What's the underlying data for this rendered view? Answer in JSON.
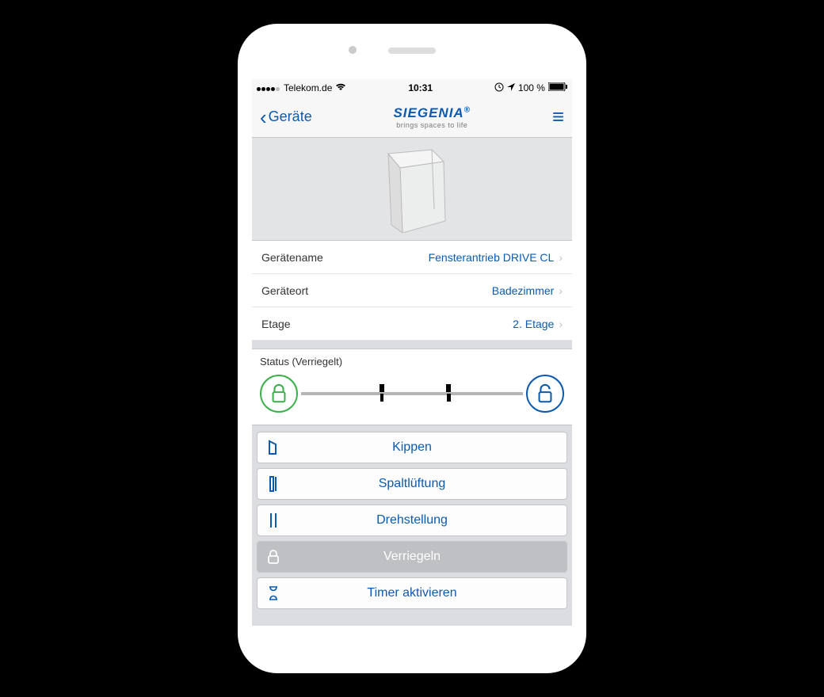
{
  "statusbar": {
    "carrier": "Telekom.de",
    "time": "10:31",
    "battery": "100 %"
  },
  "nav": {
    "back_label": "Geräte",
    "logo_main": "SIEGENIA",
    "logo_sub": "brings spaces to life"
  },
  "props": {
    "name_label": "Gerätename",
    "name_value": "Fensterantrieb DRIVE CL",
    "loc_label": "Geräteort",
    "loc_value": "Badezimmer",
    "floor_label": "Etage",
    "floor_value": "2. Etage"
  },
  "status": {
    "title": "Status (Verriegelt)"
  },
  "actions": {
    "tilt": "Kippen",
    "gap": "Spaltlüftung",
    "turn": "Drehstellung",
    "lock": "Verriegeln",
    "timer": "Timer aktivieren"
  }
}
